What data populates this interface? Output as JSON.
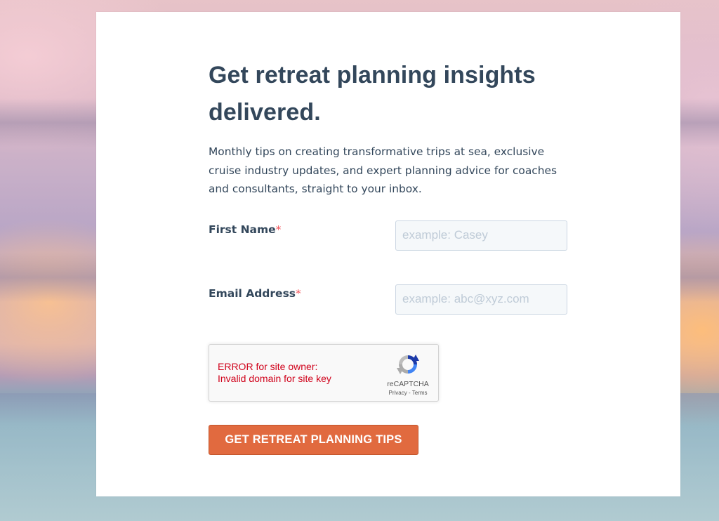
{
  "form": {
    "heading": "Get retreat planning insights delivered.",
    "description": "Monthly tips on creating transformative trips at sea, exclusive cruise industry updates, and expert planning advice for coaches and consultants, straight to your inbox.",
    "required_marker": "*",
    "fields": [
      {
        "label": "First Name",
        "placeholder": "example: Casey",
        "value": "",
        "required": true
      },
      {
        "label": "Email Address",
        "placeholder": "example: abc@xyz.com",
        "value": "",
        "required": true
      }
    ],
    "recaptcha": {
      "error_line1": "ERROR for site owner:",
      "error_line2": "Invalid domain for site key",
      "brand": "reCAPTCHA",
      "privacy_link": "Privacy",
      "separator": " - ",
      "terms_link": "Terms",
      "logo_icon": "recaptcha-logo-icon"
    },
    "submit_label": "GET RETREAT PLANNING TIPS"
  },
  "colors": {
    "heading_text": "#33475b",
    "required_marker": "#f2545b",
    "button_background": "#e16a3f",
    "button_text": "#ffffff",
    "recaptcha_error": "#d0021b"
  }
}
